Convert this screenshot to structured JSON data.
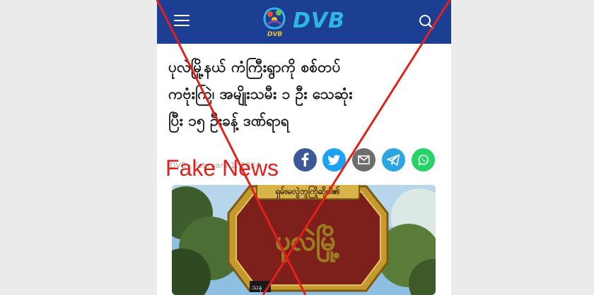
{
  "brand": {
    "name": "DVB",
    "tagline": "DVB",
    "bar_color": "#1c3f93",
    "name_color": "#2fb6e8"
  },
  "header": {
    "menu_icon": "hamburger-menu-icon",
    "search_icon": "search-icon"
  },
  "article": {
    "headline_lines": [
      "ပုလဲမြို့နယ် ကံကြီးရွာကို စစ်တပ်",
      "ကဗုံးကြဲ၊ အမျိုးသမီး ၁ ဦး သေဆုံး",
      "ပြီး ၁၅ ဦးခန့် ဒဏ်ရာရ"
    ],
    "byline": "DVB · February 1, 2024",
    "image_sign_top": "ရှမ်းမလွဲဘူကြိုဆိုပါ၏",
    "image_sign_main": "ပုလဲမြို့",
    "image_caption_fragment": "သန"
  },
  "share_buttons": [
    {
      "name": "facebook",
      "icon": "facebook-icon",
      "color": "#3b5998"
    },
    {
      "name": "twitter",
      "icon": "twitter-icon",
      "color": "#1da1f2"
    },
    {
      "name": "email",
      "icon": "email-icon",
      "color": "#6d6d6d"
    },
    {
      "name": "telegram",
      "icon": "telegram-icon",
      "color": "#2ca5e0"
    },
    {
      "name": "whatsapp",
      "icon": "whatsapp-icon",
      "color": "#25d366"
    }
  ],
  "overlay": {
    "label": "Fake News",
    "color": "#e2211c"
  }
}
